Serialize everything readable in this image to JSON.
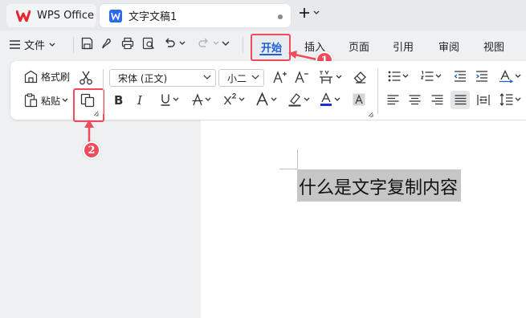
{
  "tabs": {
    "app_tab_label": "WPS Office",
    "doc_tab_label": "文字文稿1"
  },
  "menu": {
    "file_label": "文件",
    "tabs": [
      "开始",
      "插入",
      "页面",
      "引用",
      "审阅",
      "视图"
    ],
    "active_tab": "开始"
  },
  "ribbon": {
    "format_painter_label": "格式刷",
    "paste_label": "粘贴",
    "font_name": "宋体 (正文)",
    "font_size": "小二"
  },
  "annotations": {
    "callout_1": "1",
    "callout_2": "2"
  },
  "document": {
    "selected_text": "什么是文字复制内容"
  },
  "colors": {
    "accent_blue": "#1d5fd9",
    "annotation_red": "#ee4b5b",
    "wps_logo_red": "#e8262d",
    "doc_icon_blue": "#2a6ae8",
    "selection_gray": "#c6c6c6"
  }
}
